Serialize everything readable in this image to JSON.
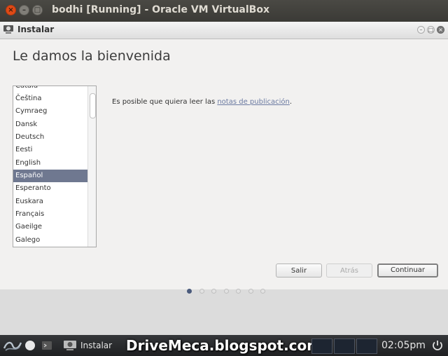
{
  "window": {
    "title": "bodhi [Running] - Oracle VM VirtualBox"
  },
  "installer": {
    "title": "Instalar",
    "heading": "Le damos la bienvenida",
    "languages": [
      "Català",
      "Čeština",
      "Cymraeg",
      "Dansk",
      "Deutsch",
      "Eesti",
      "English",
      "Español",
      "Esperanto",
      "Euskara",
      "Français",
      "Gaeilge",
      "Galego"
    ],
    "selected_language": "Español",
    "notes_prefix": "Es posible que quiera leer las ",
    "notes_link": "notas de publicación",
    "notes_suffix": ".",
    "buttons": {
      "quit": "Salir",
      "back": "Atrás",
      "continue": "Continuar"
    },
    "progress": {
      "current_step": 1,
      "total_steps": 7
    }
  },
  "taskbar": {
    "task_label": "Instalar",
    "watermark": "DriveMeca.blogspot.com",
    "clock": "02:05pm"
  }
}
